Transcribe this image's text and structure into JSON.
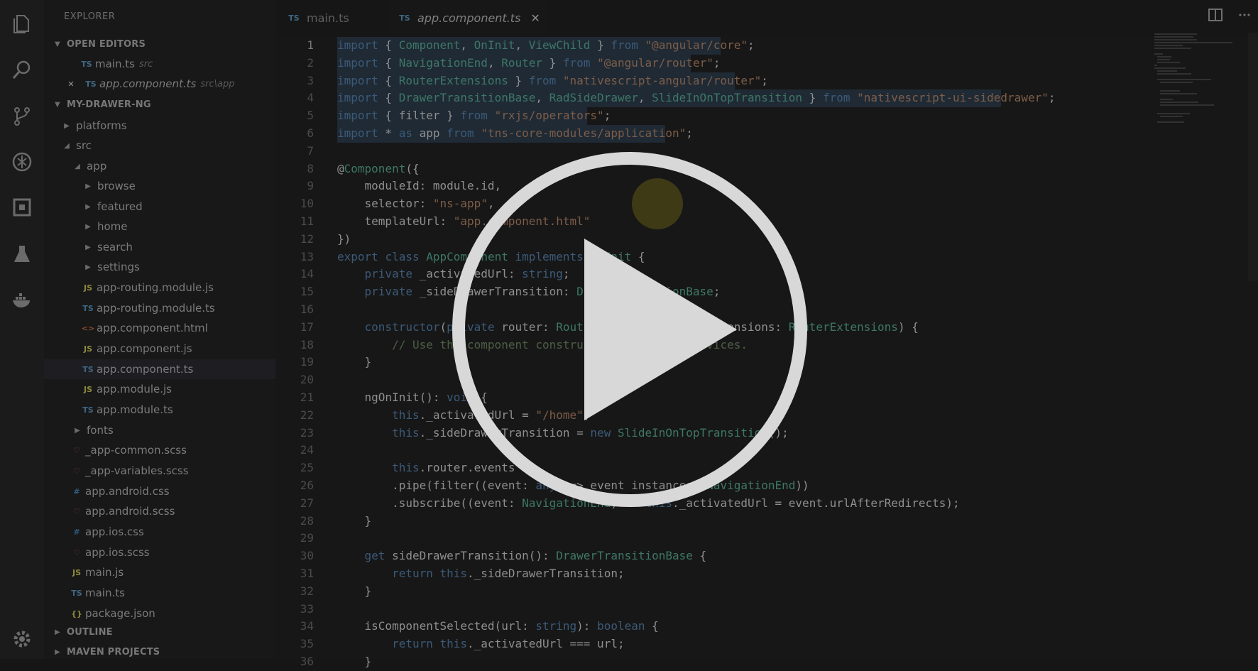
{
  "sidebar": {
    "title": "EXPLORER",
    "open_editors_label": "OPEN EDITORS",
    "open_editors": [
      {
        "icon": "TS",
        "name": "main.ts",
        "path": "src"
      },
      {
        "icon": "TS",
        "name": "app.component.ts",
        "path": "src\\app"
      }
    ],
    "project_label": "MY-DRAWER-NG",
    "tree": [
      {
        "icon": "",
        "name": "platforms"
      },
      {
        "icon": "",
        "name": "src"
      },
      {
        "icon": "",
        "name": "app"
      },
      {
        "icon": "",
        "name": "browse"
      },
      {
        "icon": "",
        "name": "featured"
      },
      {
        "icon": "",
        "name": "home"
      },
      {
        "icon": "",
        "name": "search"
      },
      {
        "icon": "",
        "name": "settings"
      },
      {
        "icon": "JS",
        "name": "app-routing.module.js"
      },
      {
        "icon": "TS",
        "name": "app-routing.module.ts"
      },
      {
        "icon": "<>",
        "name": "app.component.html"
      },
      {
        "icon": "JS",
        "name": "app.component.js"
      },
      {
        "icon": "TS",
        "name": "app.component.ts"
      },
      {
        "icon": "JS",
        "name": "app.module.js"
      },
      {
        "icon": "TS",
        "name": "app.module.ts"
      },
      {
        "icon": "",
        "name": "fonts"
      },
      {
        "icon": "♡",
        "name": "_app-common.scss"
      },
      {
        "icon": "♡",
        "name": "_app-variables.scss"
      },
      {
        "icon": "#",
        "name": "app.android.css"
      },
      {
        "icon": "♡",
        "name": "app.android.scss"
      },
      {
        "icon": "#",
        "name": "app.ios.css"
      },
      {
        "icon": "♡",
        "name": "app.ios.scss"
      },
      {
        "icon": "JS",
        "name": "main.js"
      },
      {
        "icon": "TS",
        "name": "main.ts"
      },
      {
        "icon": "{}",
        "name": "package.json"
      }
    ],
    "outline_label": "OUTLINE",
    "maven_label": "MAVEN PROJECTS"
  },
  "tabs": [
    {
      "icon": "TS",
      "label": "main.ts"
    },
    {
      "icon": "TS",
      "label": "app.component.ts",
      "close": "✕"
    }
  ],
  "editor": {
    "line_numbers": [
      "1",
      "2",
      "3",
      "4",
      "5",
      "6",
      "7",
      "8",
      "9",
      "10",
      "11",
      "12",
      "13",
      "14",
      "15",
      "16",
      "17",
      "18",
      "19",
      "20",
      "21",
      "22",
      "23",
      "24",
      "25",
      "26",
      "27",
      "28",
      "29",
      "30",
      "31",
      "32",
      "33",
      "34",
      "35",
      "36"
    ],
    "lines": [
      "import { Component, OnInit, ViewChild } from \"@angular/core\";",
      "import { NavigationEnd, Router } from \"@angular/router\";",
      "import { RouterExtensions } from \"nativescript-angular/router\";",
      "import { DrawerTransitionBase, RadSideDrawer, SlideInOnTopTransition } from \"nativescript-ui-sidedrawer\";",
      "import { filter } from \"rxjs/operators\";",
      "import * as app from \"tns-core-modules/application\";",
      "",
      "@Component({",
      "    moduleId: module.id,",
      "    selector: \"ns-app\",",
      "    templateUrl: \"app.component.html\"",
      "})",
      "export class AppComponent implements OnInit {",
      "    private _activatedUrl: string;",
      "    private _sideDrawerTransition: DrawerTransitionBase;",
      "",
      "    constructor(private router: Router, private routerExtensions: RouterExtensions) {",
      "        // Use the component constructor to inject services.",
      "    }",
      "",
      "    ngOnInit(): void {",
      "        this._activatedUrl = \"/home\";",
      "        this._sideDrawerTransition = new SlideInOnTopTransition();",
      "",
      "        this.router.events",
      "        .pipe(filter((event: any) => event instanceof NavigationEnd))",
      "        .subscribe((event: NavigationEnd) => this._activatedUrl = event.urlAfterRedirects);",
      "    }",
      "",
      "    get sideDrawerTransition(): DrawerTransitionBase {",
      "        return this._sideDrawerTransition;",
      "    }",
      "",
      "    isComponentSelected(url: string): boolean {",
      "        return this._activatedUrl === url;",
      "    }"
    ],
    "selected_lines": 6
  },
  "overlay": {
    "play_icon": "play-button-icon"
  },
  "colors": {
    "background": "#161616",
    "overlay_circle": "#d8d8d8",
    "selection": "#1f2a35"
  }
}
